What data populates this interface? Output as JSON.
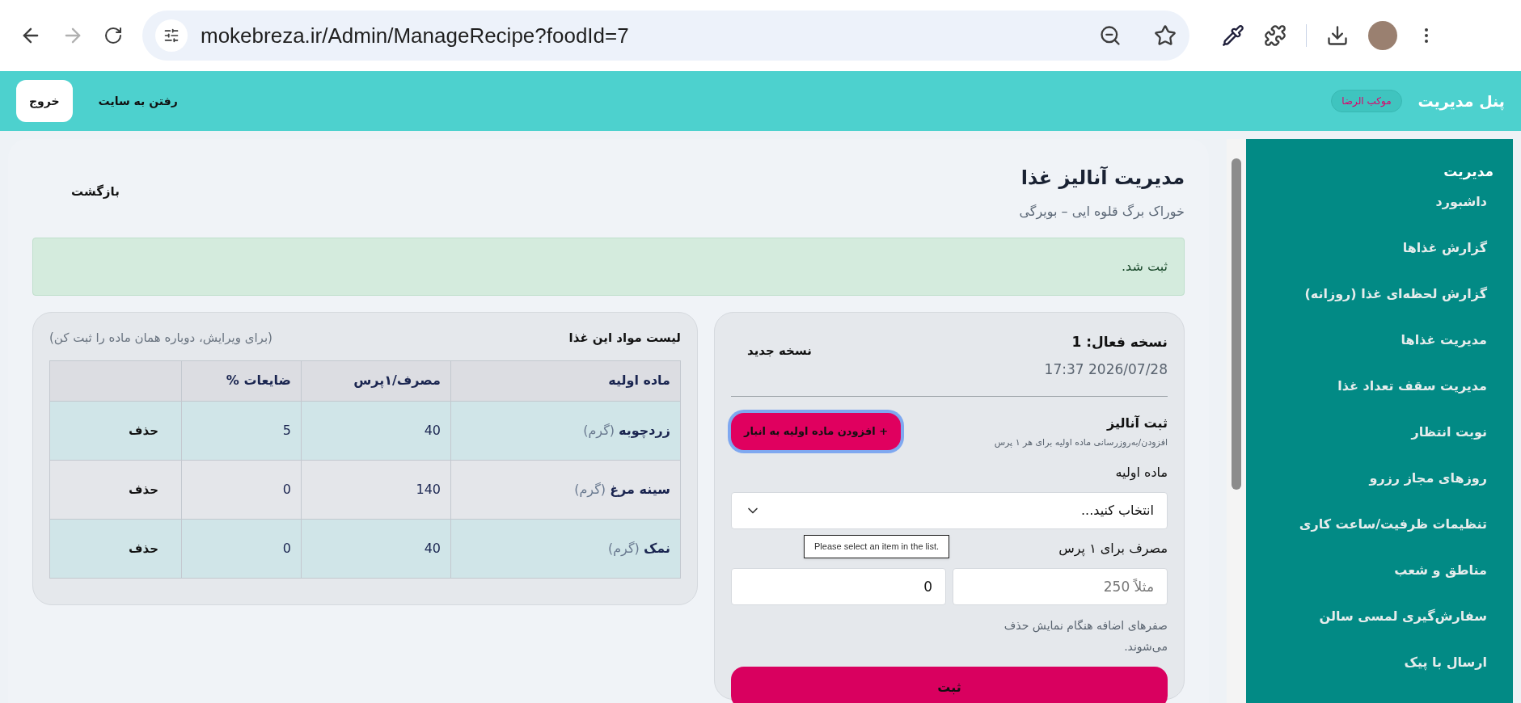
{
  "browser": {
    "url": "mokebreza.ir/Admin/ManageRecipe?foodId=7",
    "forward_disabled": true
  },
  "header": {
    "brand": "پنل مدیریت",
    "badge": "موکب الرضا",
    "site_link": "رفتن به سایت",
    "logout": "خروج"
  },
  "sidebar": {
    "title": "مدیریت",
    "items": [
      {
        "label": "داشبورد"
      },
      {
        "label": "گزارش غذاها"
      },
      {
        "label": "گزارش لحظه‌ای غذا (روزانه)"
      },
      {
        "label": "مدیریت غذاها"
      },
      {
        "label": "مدیریت سقف تعداد غذا"
      },
      {
        "label": "نوبت انتظار"
      },
      {
        "label": "روزهای مجاز رزرو"
      },
      {
        "label": "تنظیمات ظرفیت/ساعت کاری"
      },
      {
        "label": "مناطق و شعب"
      },
      {
        "label": "سفارش‌گیری لمسی سالن"
      },
      {
        "label": "ارسال با پیک"
      }
    ]
  },
  "page": {
    "title": "مدیریت آنالیز غذا",
    "subtitle": "خوراک برگ قلوه ایی – بویرگی",
    "back": "بازگشت",
    "alert": "ثبت شد."
  },
  "version": {
    "title": "نسخه فعال: 1",
    "date": "17:37 2026/07/28",
    "new_button": "نسخه جدید",
    "section_title": "ثبت آنالیز",
    "section_hint": "افزودن/به‌روزرسانی ماده اولیه برای هر ۱ پرس",
    "add_button": "+ افزودن ماده اولیه به انبار",
    "material_label": "ماده اولیه",
    "select_value": "انتخاب کنید...",
    "tooltip": "Please select an item in the list.",
    "usage_label": "مصرف برای ۱ پرس",
    "usage_placeholder": "مثلاً 250",
    "waste_value": "0",
    "hint": "صفرهای اضافه هنگام نمایش حذف می‌شوند.",
    "submit": "ثبت"
  },
  "table": {
    "title": "لیست مواد این غذا",
    "note": "(برای ویرایش، دوباره همان ماده را ثبت کن)",
    "columns": [
      "ماده اولیه",
      "مصرف/۱پرس",
      "ضایعات %"
    ],
    "rows": [
      {
        "name": "زردچوبه",
        "unit": "(گرم)",
        "usage": "40",
        "waste": "5",
        "action": "حذف"
      },
      {
        "name": "سینه مرغ",
        "unit": "(گرم)",
        "usage": "140",
        "waste": "0",
        "action": "حذف"
      },
      {
        "name": "نمک",
        "unit": "(گرم)",
        "usage": "40",
        "waste": "0",
        "action": "حذف"
      }
    ]
  }
}
